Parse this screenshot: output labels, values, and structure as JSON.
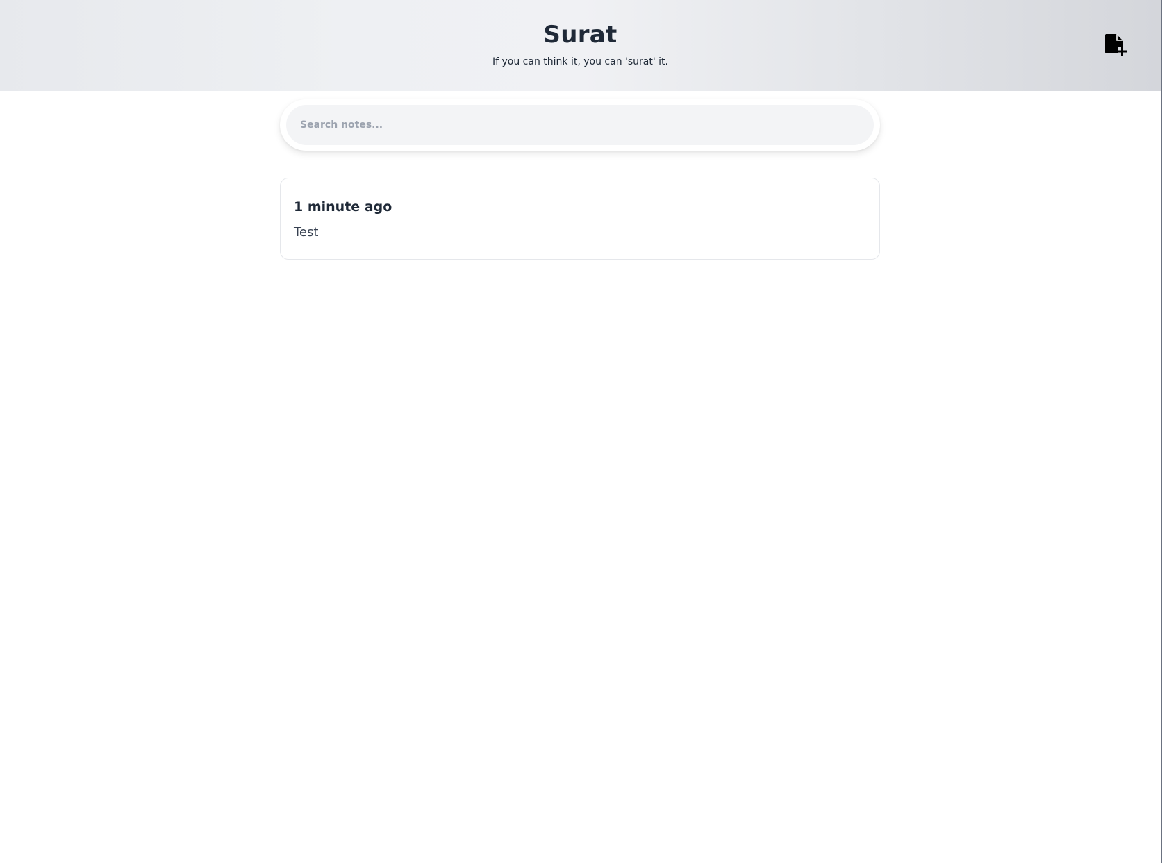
{
  "header": {
    "title": "Surat",
    "tagline": "If you can think it, you can 'surat' it.",
    "new_note_icon": "file-plus-icon"
  },
  "search": {
    "placeholder": "Search notes...",
    "value": ""
  },
  "notes": [
    {
      "time": "1 minute ago",
      "body": "Test"
    }
  ],
  "colors": {
    "text": "#1f2937",
    "search_bg": "#f3f4f6",
    "card_border": "#e5e7eb"
  }
}
